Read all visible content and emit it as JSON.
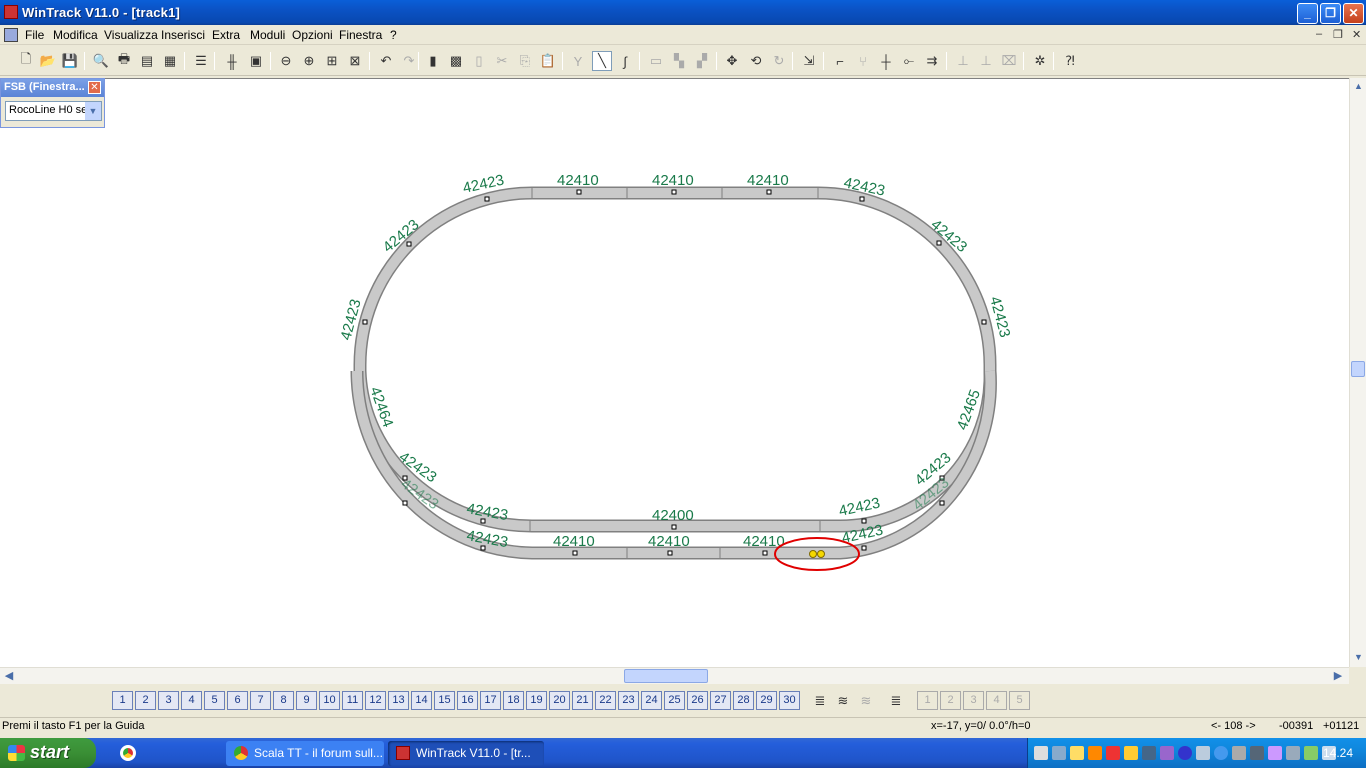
{
  "window": {
    "title": "WinTrack  V11.0 - [track1]",
    "buttons": {
      "minimize": "_",
      "restore": "❐",
      "close": "✕"
    }
  },
  "menu": {
    "items": [
      "File",
      "Modifica",
      "Visualizza",
      "Inserisci",
      "Extra",
      "Moduli",
      "Opzioni",
      "Finestra",
      "?"
    ],
    "mdi_buttons": {
      "minimize": "–",
      "restore": "❐",
      "close": "✕"
    }
  },
  "toolbar": {
    "icons": [
      "new-icon",
      "open-icon",
      "save-icon",
      "print-preview-icon",
      "print-icon",
      "print-setup-icon",
      "calculator-icon",
      "parts-list-icon",
      "properties-icon",
      "image-icon",
      "zoom-out-icon",
      "zoom-in-icon",
      "zoom-window-icon",
      "zoom-all-icon",
      "undo-icon",
      "redo-icon",
      "copy-page-icon",
      "paste-page-icon",
      "delete-icon",
      "cut-icon",
      "copy-icon",
      "paste-icon",
      "switch-icon",
      "straight-line-icon",
      "curve-icon",
      "grid-icon",
      "group-icon",
      "ungroup-icon",
      "move-icon",
      "rotate-icon",
      "rotate-180-icon",
      "connect-icon",
      "flex-track-icon",
      "cut-track-icon",
      "join-icon",
      "split-icon",
      "turnout-icon",
      "align-icon",
      "align-2-icon",
      "align-3-icon",
      "settings-icon",
      "help-icon"
    ]
  },
  "fsb": {
    "title": "FSB (Finestra...",
    "selected": "RocoLine H0 se"
  },
  "track": {
    "labels_outer": [
      "42423",
      "42410",
      "42410",
      "42410",
      "42423",
      "42423",
      "42423",
      "42423",
      "42423",
      "42465",
      "42423",
      "42423",
      "42423",
      "42400",
      "42423",
      "42423"
    ],
    "labels_bottom": [
      "42423",
      "42410",
      "42410",
      "42410",
      "42423",
      "42423",
      "42464"
    ],
    "highlight": "connection-marker"
  },
  "layers": {
    "buttons": [
      "1",
      "2",
      "3",
      "4",
      "5",
      "6",
      "7",
      "8",
      "9",
      "10",
      "11",
      "12",
      "13",
      "14",
      "15",
      "16",
      "17",
      "18",
      "19",
      "20",
      "21",
      "22",
      "23",
      "24",
      "25",
      "26",
      "27",
      "28",
      "29",
      "30"
    ],
    "extra": [
      "1",
      "2",
      "3",
      "4",
      "5"
    ]
  },
  "status": {
    "help": "Premi il tasto F1 per la Guida",
    "coords": "x=-17, y=0/ 0.0°/h=0",
    "distance": "<- 108 ->",
    "x_value": "-00391",
    "y_value": "+01121"
  },
  "taskbar": {
    "start": "start",
    "tasks": [
      "Scala TT - il forum sull...",
      "WinTrack  V11.0 - [tr..."
    ],
    "clock": "14.24"
  },
  "colors": {
    "track_fill": "#c9c9c9",
    "track_stroke": "#808080",
    "label": "#1a7a4a",
    "highlight": "#e00000"
  }
}
